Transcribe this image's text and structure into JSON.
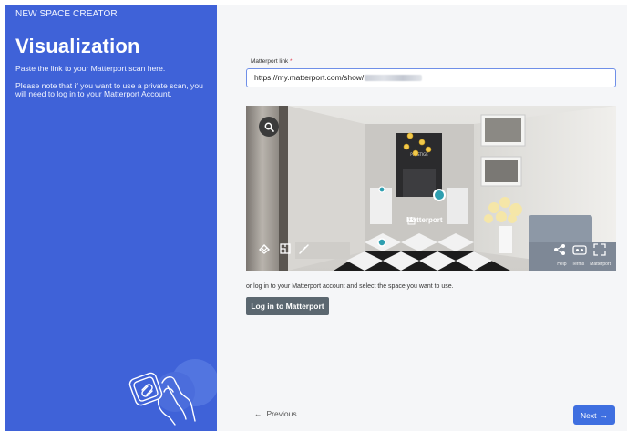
{
  "sidebar": {
    "caption": "NEW SPACE CREATOR",
    "title": "Visualization",
    "text1": "Paste the link to your Matterport scan here.",
    "text2": "Please note that if you want to use a private scan, you will need to log in to your Matterport Account."
  },
  "form": {
    "label": "Matterport link",
    "required_mark": "*",
    "url_value": "https://my.matterport.com/show/"
  },
  "preview": {
    "logo": "Matterport",
    "footer_links": [
      "Help",
      "Terms",
      "Matterport"
    ]
  },
  "note": "or log in to your Matterport account and select the space you want to use.",
  "login_label": "Log in to Matterport",
  "nav": {
    "previous_label": "Previous",
    "next_label": "Next"
  },
  "colors": {
    "sidebar_bg": "#3f62d8",
    "button_dark": "#5b6770",
    "next_bg": "#3f6fe0"
  }
}
